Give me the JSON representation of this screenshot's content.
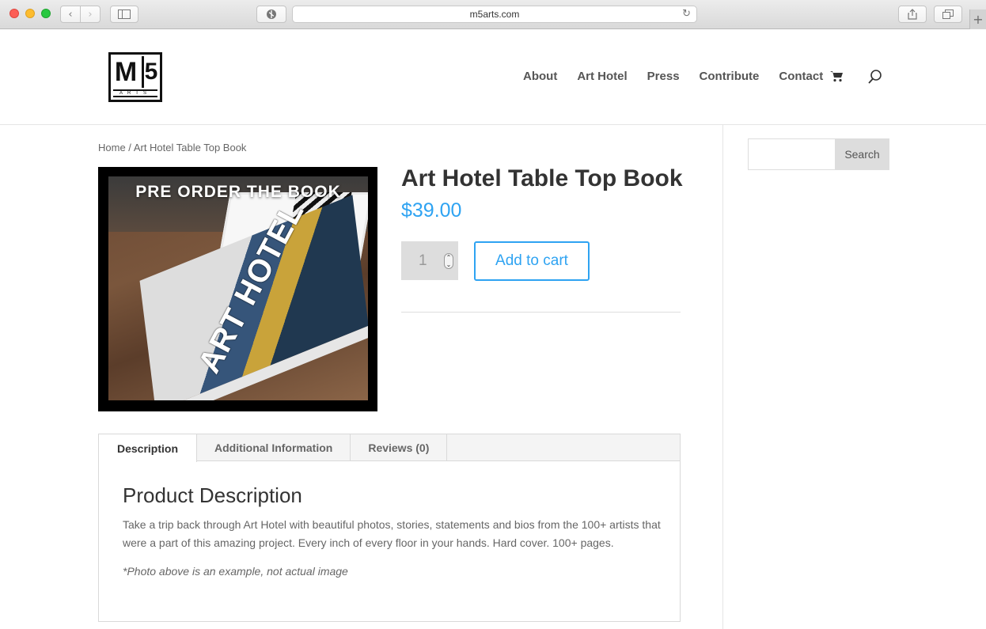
{
  "browser": {
    "url": "m5arts.com",
    "back_icon": "‹",
    "forward_icon": "›",
    "reload_icon": "↻",
    "newtab_icon": "+"
  },
  "site": {
    "logo_text_m": "M",
    "logo_text_5": "5",
    "logo_text_arts": "ARTS",
    "nav": [
      "About",
      "Art Hotel",
      "Press",
      "Contribute",
      "Contact"
    ],
    "accent_color": "#2ea3f2"
  },
  "breadcrumb": {
    "home": "Home",
    "separator": " / ",
    "current": "Art Hotel Table Top Book"
  },
  "product": {
    "image_headline": "PRE ORDER THE BOOK",
    "image_book_title": "ART HOTEL",
    "title": "Art Hotel Table Top Book",
    "price": "$39.00",
    "quantity": "1",
    "add_to_cart": "Add to cart"
  },
  "tabs": {
    "items": [
      "Description",
      "Additional Information",
      "Reviews (0)"
    ],
    "active": "Description",
    "heading": "Product Description",
    "body": "Take a trip back through Art Hotel with beautiful photos, stories, statements and bios from the 100+ artists that were a part of this amazing project. Every inch of every floor in your hands. Hard cover. 100+ pages.",
    "note": "*Photo above is an example, not actual image"
  },
  "sidebar": {
    "search_placeholder": "",
    "search_button": "Search"
  }
}
